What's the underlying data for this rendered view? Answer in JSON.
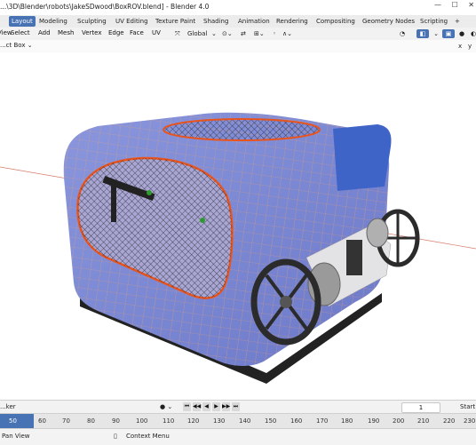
{
  "window": {
    "title": "...\\3D\\Blender\\robots\\JakeSDwood\\BoxROV.blend] - Blender 4.0",
    "controls": [
      "minimize-icon",
      "maximize-icon",
      "close-icon"
    ]
  },
  "workspace_tabs": [
    "Layout",
    "Modeling",
    "Sculpting",
    "UV Editing",
    "Texture Paint",
    "Shading",
    "Animation",
    "Rendering",
    "Compositing",
    "Geometry Nodes",
    "Scripting",
    "+"
  ],
  "active_tab": "Layout",
  "header_menus": [
    "View",
    "Select",
    "Add",
    "Mesh",
    "Vertex",
    "Edge",
    "Face",
    "UV"
  ],
  "transform_orientation": "Global",
  "toolbar": {
    "select_box": "...ct Box"
  },
  "timeline": {
    "marker_label": "...ker",
    "current_frame": "1",
    "start_label": "Start"
  },
  "ruler": {
    "labels": [
      "50",
      "60",
      "70",
      "80",
      "90",
      "100",
      "110",
      "120",
      "130",
      "140",
      "150",
      "160",
      "170",
      "180",
      "190",
      "200",
      "210",
      "220",
      "230"
    ]
  },
  "statusbar": {
    "left": "Pan View",
    "right": "Context Menu"
  },
  "colors": {
    "accent": "#4772b3",
    "hull": "#7a88d6",
    "selection_edge": "#e8541c",
    "wire": "#f0a060"
  }
}
